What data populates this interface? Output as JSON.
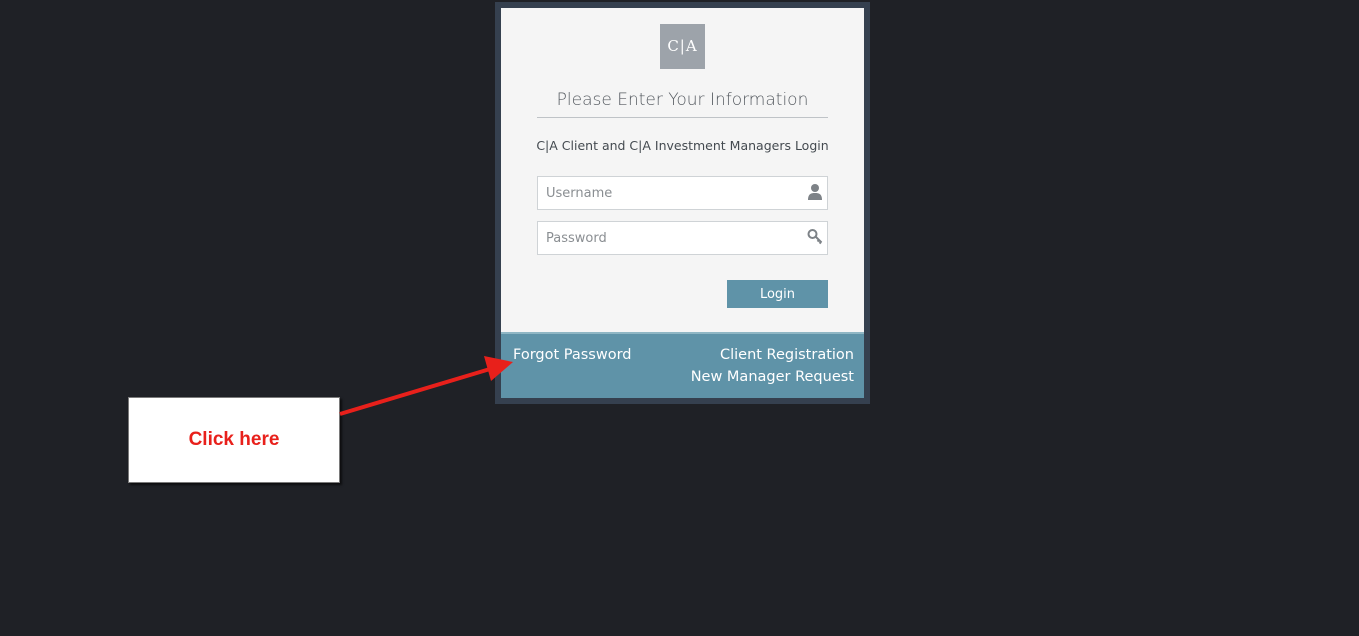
{
  "logo": {
    "text": "C|A"
  },
  "login": {
    "title": "Please Enter Your Information",
    "subtitle": "C|A Client and C|A Investment Managers Login",
    "username_placeholder": "Username",
    "password_placeholder": "Password",
    "username_icon": "user-icon",
    "password_icon": "key-icon",
    "button_label": "Login"
  },
  "footer": {
    "forgot_password": "Forgot Password",
    "client_registration": "Client Registration",
    "new_manager_request": "New Manager Request"
  },
  "annotation": {
    "callout_text": "Click here",
    "color": "#e8201b"
  },
  "colors": {
    "background": "#1f2126",
    "accent": "#5f93a8",
    "frame": "#35404f"
  }
}
